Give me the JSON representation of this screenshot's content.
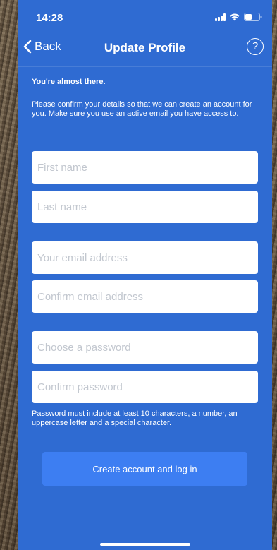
{
  "status_bar": {
    "time": "14:28"
  },
  "nav": {
    "back_label": "Back",
    "title": "Update Profile",
    "help_label": "?"
  },
  "content": {
    "headline": "You're almost there.",
    "intro": "Please confirm your details so that we can create an account for you. Make sure you use an active email you have access to."
  },
  "form": {
    "first_name": {
      "placeholder": "First name",
      "value": ""
    },
    "last_name": {
      "placeholder": "Last name",
      "value": ""
    },
    "email": {
      "placeholder": "Your email address",
      "value": ""
    },
    "confirm_email": {
      "placeholder": "Confirm email address",
      "value": ""
    },
    "password": {
      "placeholder": "Choose a password",
      "value": ""
    },
    "confirm_password": {
      "placeholder": "Confirm password",
      "value": ""
    },
    "password_hint": "Password must include at least 10 characters, a number, an uppercase letter and a special character.",
    "submit_label": "Create account and log in"
  },
  "colors": {
    "background": "#2f6bd2",
    "button": "#3d7ef2",
    "field": "#ffffff"
  }
}
